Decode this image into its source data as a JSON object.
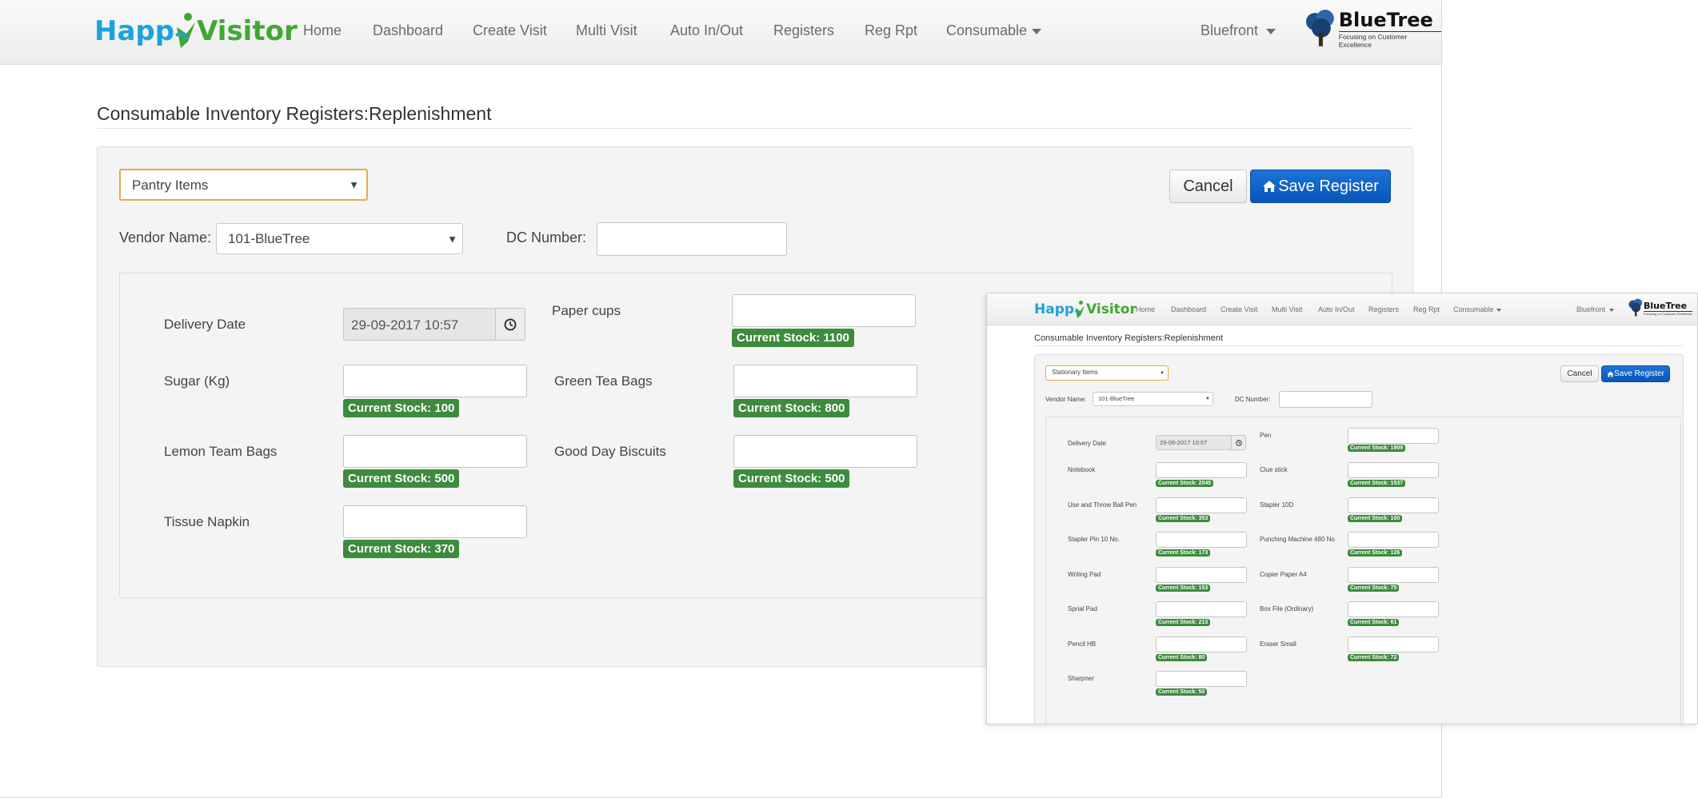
{
  "main": {
    "brand": {
      "part1": "Happ",
      "part2": "Visitor"
    },
    "nav": [
      "Home",
      "Dashboard",
      "Create Visit",
      "Multi Visit",
      "Auto In/Out",
      "Registers",
      "Reg Rpt",
      "Consumable"
    ],
    "user_menu": "Bluefront",
    "client_logo": {
      "name": "BlueTree",
      "tagline": "Focusing on Customer Excellence"
    },
    "page_title": "Consumable Inventory Registers:Replenishment",
    "category_select": "Pantry Items",
    "cancel_label": "Cancel",
    "save_label": "Save Register",
    "vendor_label": "Vendor Name:",
    "vendor_value": "101-BlueTree",
    "dc_label": "DC Number:",
    "dc_value": "",
    "delivery_label": "Delivery Date",
    "delivery_value": "29-09-2017 10:57",
    "items": [
      {
        "name": "Paper cups",
        "stock": "Current Stock: 1100"
      },
      {
        "name": "Sugar (Kg)",
        "stock": "Current Stock: 100"
      },
      {
        "name": "Green Tea Bags",
        "stock": "Current Stock: 800"
      },
      {
        "name": "Lemon Team Bags",
        "stock": "Current Stock: 500"
      },
      {
        "name": "Good Day Biscuits",
        "stock": "Current Stock: 500"
      },
      {
        "name": "Tissue Napkin",
        "stock": "Current Stock: 370"
      }
    ]
  },
  "overlay": {
    "brand": {
      "part1": "Happ",
      "part2": "Visitor"
    },
    "nav": [
      "Home",
      "Dashboard",
      "Create Visit",
      "Multi Visit",
      "Auto In/Out",
      "Registers",
      "Reg Rpt",
      "Consumable"
    ],
    "user_menu": "Bluefront",
    "client_logo": {
      "name": "BlueTree",
      "tagline": "Focusing on Customer Excellence"
    },
    "page_title": "Consumable Inventory Registers:Replenishment",
    "category_select": "Stationary Items",
    "cancel_label": "Cancel",
    "save_label": "Save Register",
    "vendor_label": "Vendor Name:",
    "vendor_value": "101-BlueTree",
    "dc_label": "DC Number:",
    "delivery_label": "Delivery Date",
    "delivery_value": "29-09-2017 10:57",
    "items": [
      {
        "name": "Pen",
        "stock": "Current Stock: 1909"
      },
      {
        "name": "Notebook",
        "stock": "Current Stock: 2045"
      },
      {
        "name": "Clue stick",
        "stock": "Current Stock: 1537"
      },
      {
        "name": "Use and Throw Ball Pen",
        "stock": "Current Stock: 353"
      },
      {
        "name": "Stapler 10D",
        "stock": "Current Stock: 100"
      },
      {
        "name": "Stapler Pin 10 No.",
        "stock": "Current Stock: 173"
      },
      {
        "name": "Punching Machine 480 No",
        "stock": "Current Stock: 126"
      },
      {
        "name": "Writing Pad",
        "stock": "Current Stock: 153"
      },
      {
        "name": "Copier Paper A4",
        "stock": "Current Stock: 75"
      },
      {
        "name": "Sprial Pad",
        "stock": "Current Stock: 213"
      },
      {
        "name": "Box File (Ordinary)",
        "stock": "Current Stock: 61"
      },
      {
        "name": "Pencil HB",
        "stock": "Current Stock: 80"
      },
      {
        "name": "Eraser Small",
        "stock": "Current Stock: 72"
      },
      {
        "name": "Sharpner",
        "stock": "Current Stock: 50"
      }
    ]
  },
  "colors": {
    "stock_badge": "#3d8b3d",
    "save_button": "#0a56b8",
    "brand_blue": "#1ba3db",
    "brand_green": "#3fa833",
    "select_focus": "#e6a94a"
  },
  "icons": {
    "save": "home-icon",
    "date_picker": "clock-icon",
    "dropdown": "caret-down-icon"
  }
}
